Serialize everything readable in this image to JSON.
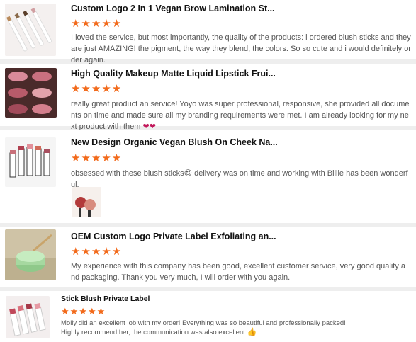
{
  "reviews": [
    {
      "product_title": "Custom Logo 2 In 1 Vegan Brow Lamination St...",
      "stars": "★★★★★",
      "rating": 5,
      "text": "I loved the service, but most importantly, the quality of the products: i ordered blush sticks and they are just AMAZING! the pigment, the way they blend, the colors. So so cute and i would definitely order again."
    },
    {
      "product_title": "High Quality Makeup Matte Liquid Lipstick Frui...",
      "stars": "★★★★★",
      "rating": 5,
      "text": "really great product an service! Yoyo was super professional, responsive, she provided all documents on time and made sure all my branding requirements were met. I am already looking for my next product with them ",
      "emoji": "❤❤"
    },
    {
      "product_title": "New Design Organic Vegan Blush On Cheek Na...",
      "stars": "★★★★★",
      "rating": 5,
      "text": "obsessed with these blush sticks",
      "emoji": "😍",
      "text_after": " delivery was on time and working with Billie has been wonderful."
    },
    {
      "product_title": "OEM Custom Logo Private Label Exfoliating an...",
      "stars": "★★★★★",
      "rating": 5,
      "text": "My experience with this company has been good, excellent customer service, very good quality and packaging. Thank you very much, I will order with you again."
    },
    {
      "product_title": "Stick Blush Private Label",
      "stars": "★★★★★",
      "rating": 5,
      "text": "Molly did an excellent job with my order! Everything was so beautiful and professionally packed! Highly recommend her, the communication was also excellent ",
      "emoji": "👍"
    }
  ],
  "colors": {
    "star": "#f26a1b",
    "background": "#eeeeee",
    "card": "#ffffff"
  }
}
